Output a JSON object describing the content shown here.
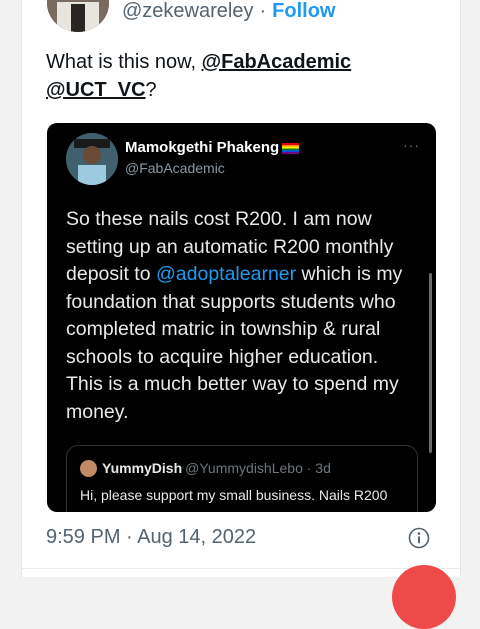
{
  "author": {
    "handle": "@zekewareley",
    "separator": "·",
    "follow_label": "Follow"
  },
  "tweet": {
    "text_prefix": "What is this now, ",
    "mention_1": "@FabAcademic",
    "mention_2": "@UCT_VC",
    "text_suffix": "?",
    "timestamp": "9:59 PM · Aug 14, 2022"
  },
  "embedded_tweet": {
    "name": "Mamokgethi Phakeng",
    "handle": "@FabAcademic",
    "more_label": "···",
    "text_before": "So these nails cost R200. I am now setting up an automatic R200 monthly deposit to ",
    "link": "@adoptalearner",
    "text_after": " which is my foundation that supports students who completed matric in township & rural schools to acquire higher education. This is a much better way to spend my money."
  },
  "inner_quote": {
    "name": "YummyDish",
    "handle_time": "@YummydishLebo · 3d",
    "text": "Hi, please support my small business. Nails R200"
  },
  "colors": {
    "accent": "#1d9bf0",
    "fab": "#ef4a4a",
    "embed_bg": "#000000"
  },
  "icons": {
    "info": "info-circle-icon",
    "flag": "rainbow-flag-icon"
  }
}
